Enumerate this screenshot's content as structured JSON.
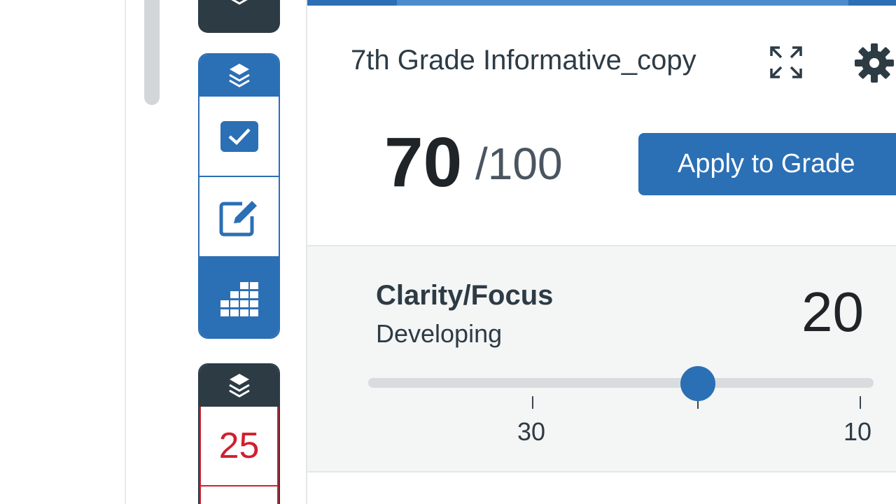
{
  "rubric": {
    "title": "7th Grade Informative_copy",
    "score": "70",
    "score_total": "/100",
    "apply_label": "Apply to Grade"
  },
  "criterion": {
    "name": "Clarity/Focus",
    "rating": "Developing",
    "points": "20",
    "slider_value": 20,
    "slider_range": [
      40,
      10
    ],
    "tick_labels": [
      "30",
      "10"
    ]
  },
  "tools": {
    "score_value": "25"
  },
  "colors": {
    "accent": "#2b6fb5",
    "dark": "#2d3b45",
    "score_red": "#d0202e"
  }
}
